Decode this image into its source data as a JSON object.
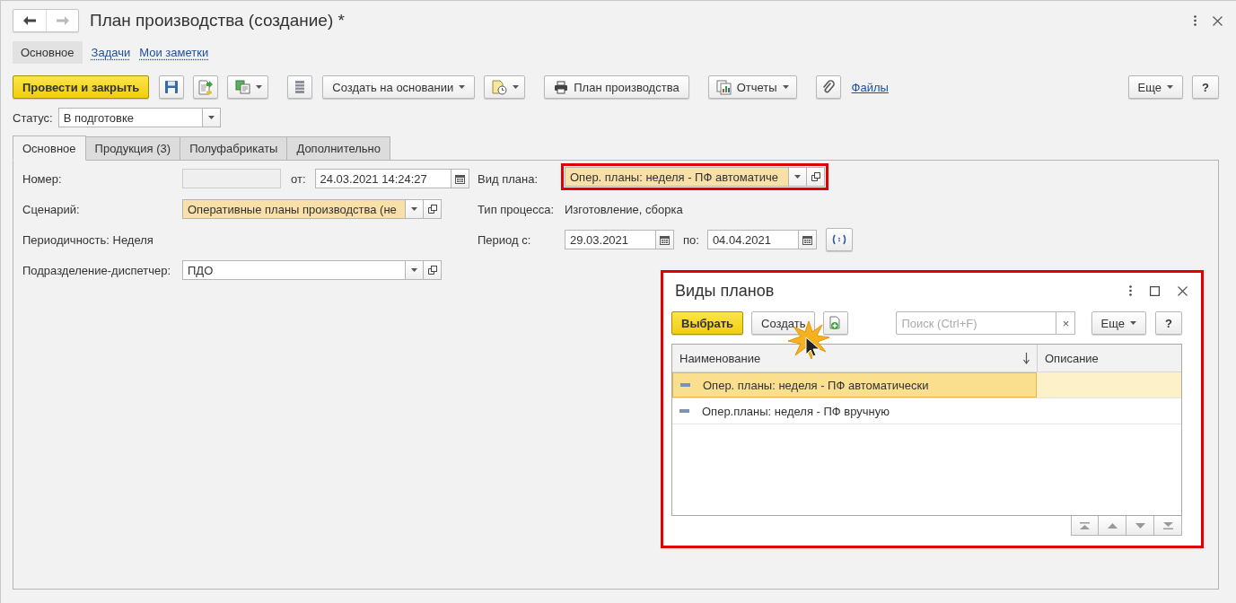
{
  "window": {
    "title": "План производства (создание) *"
  },
  "nav_tabs": [
    {
      "label": "Основное",
      "selected": true
    },
    {
      "label": "Задачи",
      "selected": false
    },
    {
      "label": "Мои заметки",
      "selected": false
    }
  ],
  "toolbar": [
    {
      "kind": "primary",
      "label": "Провести и закрыть"
    },
    {
      "kind": "icon"
    },
    {
      "kind": "icon"
    },
    {
      "kind": "icon_menu"
    },
    {
      "kind": "icon"
    },
    {
      "kind": "menu",
      "label": "Создать на основании"
    },
    {
      "kind": "icon_menu"
    },
    {
      "kind": "icon_text",
      "label": "План производства"
    },
    {
      "kind": "icon_menu_text",
      "label": "Отчеты"
    },
    {
      "kind": "icon"
    },
    {
      "kind": "link",
      "label": "Файлы"
    }
  ],
  "toolbar_right": [
    {
      "kind": "menu",
      "label": "Еще"
    },
    {
      "kind": "text",
      "label": "?"
    }
  ],
  "status": {
    "label": "Статус:",
    "value": "В подготовке"
  },
  "tabs": [
    {
      "label": "Основное",
      "selected": true
    },
    {
      "label": "Продукция (3)",
      "selected": false
    },
    {
      "label": "Полуфабрикаты",
      "selected": false
    },
    {
      "label": "Дополнительно",
      "selected": false
    }
  ],
  "form": {
    "number": {
      "label": "Номер:"
    },
    "date": {
      "label": "от:",
      "value": "24.03.2021 14:24:27"
    },
    "scenario": {
      "label": "Сценарий:",
      "value": "Оперативные планы производства (не",
      "highlighted": true
    },
    "periodicity": "Периодичность: Неделя",
    "department": {
      "label": "Подразделение-диспетчер:",
      "value": "ПДО",
      "highlighted": false
    },
    "plan_kind": {
      "label": "Вид плана:",
      "value": "Опер. планы: неделя - ПФ автоматиче",
      "highlighted": true,
      "outlined": true
    },
    "process_type": {
      "label": "Тип процесса:",
      "value": "Изготовление, сборка"
    },
    "period": {
      "label": "Период с:",
      "from": "29.03.2021",
      "to_label": "по:",
      "to": "04.04.2021"
    }
  },
  "dialog": {
    "title": "Виды планов",
    "outlined": true,
    "toolbar": [
      {
        "kind": "primary",
        "label": "Выбрать"
      },
      {
        "kind": "text",
        "label": "Создать"
      },
      {
        "kind": "icon"
      }
    ],
    "search": {
      "placeholder": "Поиск (Ctrl+F)",
      "clear": "×"
    },
    "toolbar_right": [
      {
        "kind": "menu",
        "label": "Еще"
      },
      {
        "kind": "text",
        "label": "?"
      }
    ],
    "columns": [
      "Наименование",
      "Описание"
    ],
    "rows": [
      {
        "name": "Опер. планы: неделя - ПФ автоматически",
        "selected": true
      },
      {
        "name": "Опер.планы: неделя - ПФ вручную",
        "selected": false
      }
    ]
  }
}
